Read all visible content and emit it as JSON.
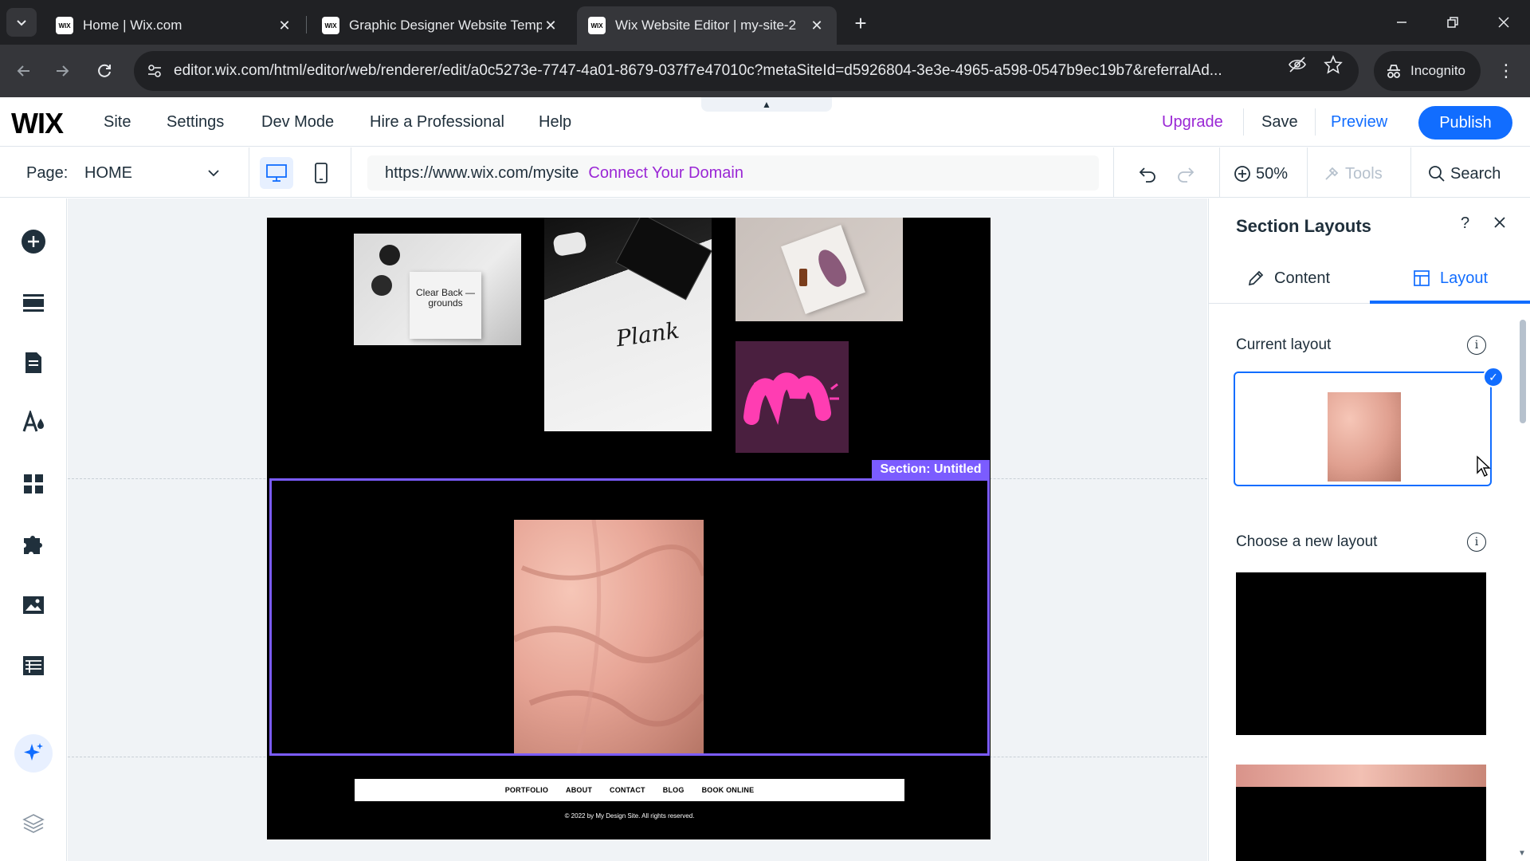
{
  "browser": {
    "tabs": [
      {
        "title": "Home | Wix.com",
        "favicon": "WIX"
      },
      {
        "title": "Graphic Designer Website Temp",
        "favicon": "WIX"
      },
      {
        "title": "Wix Website Editor | my-site-2",
        "favicon": "WIX"
      }
    ],
    "url": "editor.wix.com/html/editor/web/renderer/edit/a0c5273e-7747-4a01-8679-037f7e47010c?metaSiteId=d5926804-3e3e-4965-a598-0547b9ec19b7&referralAd...",
    "incognito_label": "Incognito"
  },
  "editor_top": {
    "logo": "WIX",
    "menu": [
      "Site",
      "Settings",
      "Dev Mode",
      "Hire a Professional",
      "Help"
    ],
    "upgrade": "Upgrade",
    "save": "Save",
    "preview": "Preview",
    "publish": "Publish"
  },
  "editor_bar": {
    "page_label": "Page:",
    "page_value": "HOME",
    "site_url": "https://www.wix.com/mysite",
    "connect_domain": "Connect Your Domain",
    "zoom": "50%",
    "tools": "Tools",
    "search": "Search"
  },
  "canvas": {
    "section_tag": "Section: Untitled",
    "card_text": "Clear Back — grounds",
    "brand_text": "Plank",
    "site_nav": [
      "PORTFOLIO",
      "ABOUT",
      "CONTACT",
      "BLOG",
      "BOOK ONLINE"
    ],
    "copyright": "© 2022 by My Design Site. All rights reserved."
  },
  "panel": {
    "title": "Section Layouts",
    "help": "?",
    "tabs": [
      "Content",
      "Layout"
    ],
    "current_layout_label": "Current layout",
    "choose_layout_label": "Choose a new layout"
  },
  "colors": {
    "accent": "#116dff",
    "selection": "#7b5cff",
    "domain_link": "#9a27d5",
    "upgrade": "#9a27d5"
  }
}
